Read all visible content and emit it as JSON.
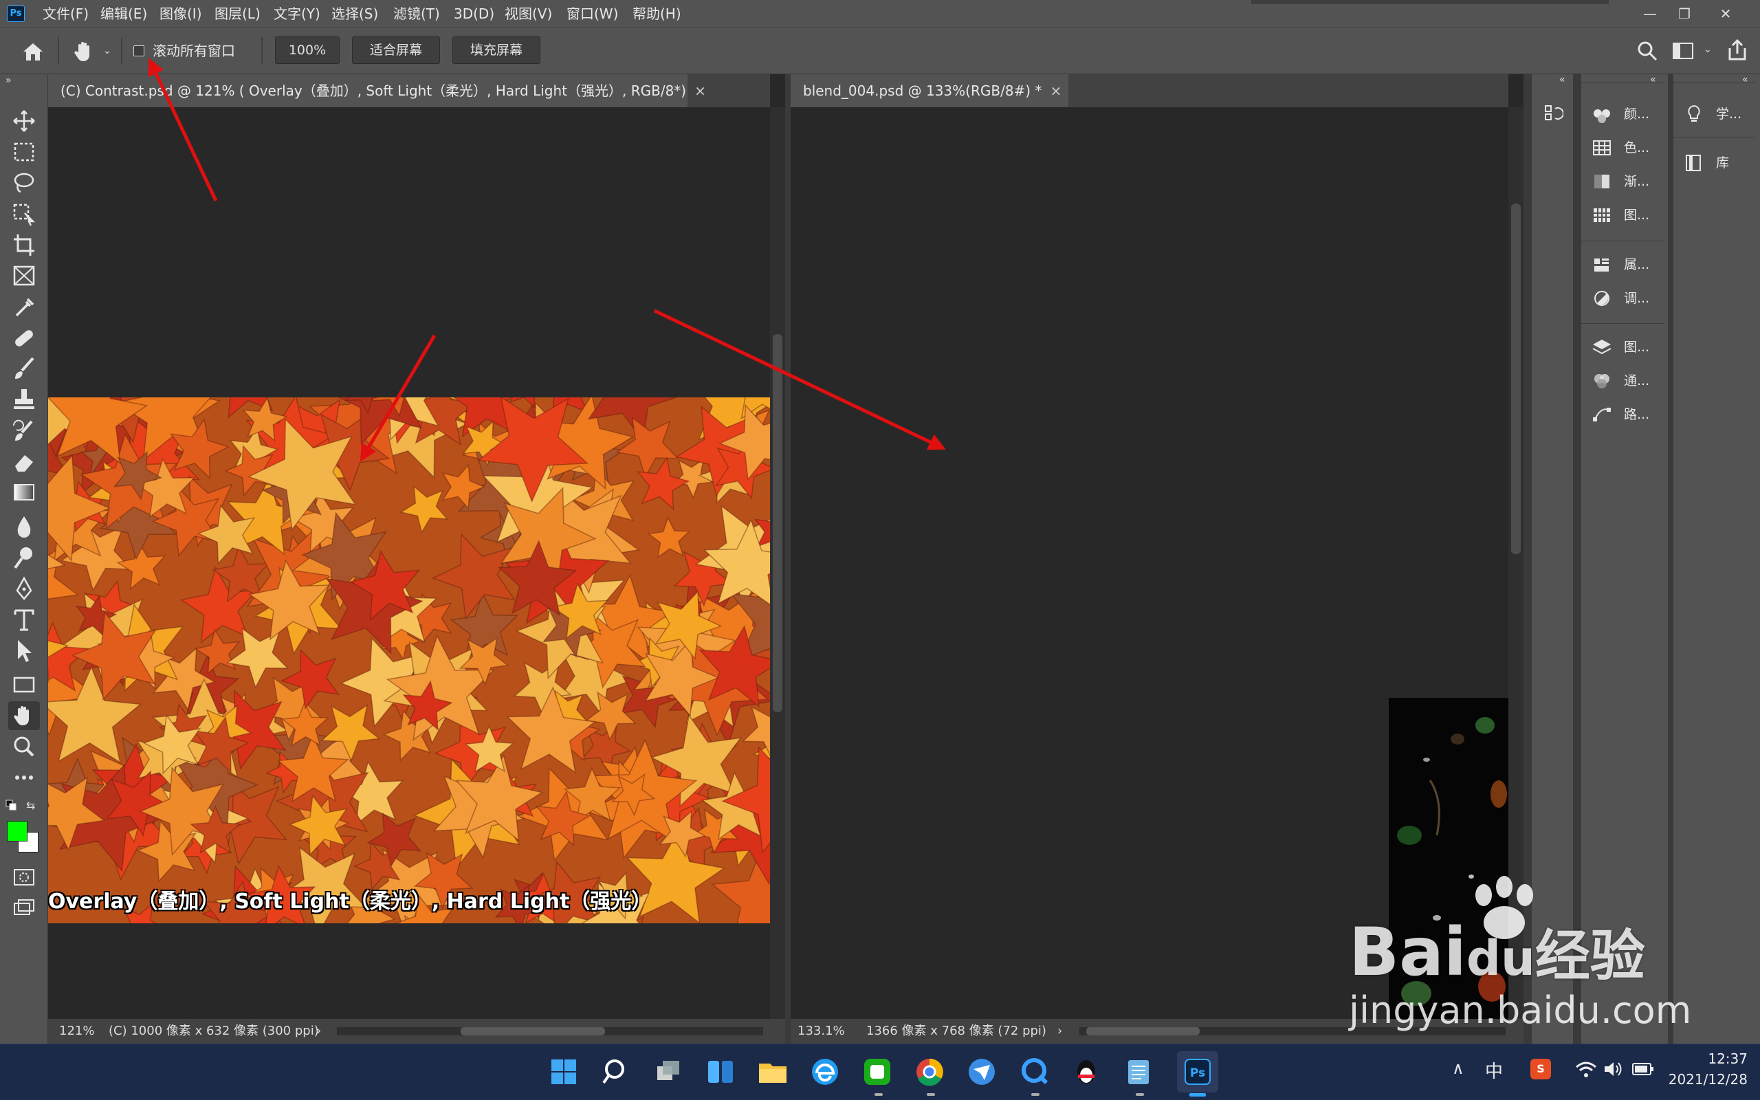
{
  "app": {
    "logo": "Ps"
  },
  "menu": [
    "文件(F)",
    "编辑(E)",
    "图像(I)",
    "图层(L)",
    "文字(Y)",
    "选择(S)",
    "滤镜(T)",
    "3D(D)",
    "视图(V)",
    "窗口(W)",
    "帮助(H)"
  ],
  "window_controls": {
    "minimize": "—",
    "restore": "❐",
    "close": "✕"
  },
  "options": {
    "scroll_all_label": "滚动所有窗口",
    "scroll_all_checked": false,
    "zoom_btn": "100%",
    "fit_screen": "适合屏幕",
    "fill_screen": "填充屏幕"
  },
  "tools": [
    "move-tool-icon",
    "marquee-tool-icon",
    "lasso-tool-icon",
    "object-select-tool-icon",
    "crop-tool-icon",
    "frame-tool-icon",
    "eyedropper-tool-icon",
    "healing-brush-icon",
    "brush-tool-icon",
    "clone-stamp-icon",
    "history-brush-icon",
    "eraser-tool-icon",
    "gradient-tool-icon",
    "blur-tool-icon",
    "dodge-tool-icon",
    "pen-tool-icon",
    "type-tool-icon",
    "path-select-tool-icon",
    "rectangle-tool-icon",
    "hand-tool-icon",
    "zoom-tool-icon",
    "more-tools-icon"
  ],
  "colors": {
    "foreground": "#00ff00",
    "background": "#ffffff",
    "accent": "#31a8ff",
    "arrow": "#e01010"
  },
  "doc1": {
    "tab": "(C) Contrast.psd @ 121% ( Overlay（叠加）, Soft Light（柔光）, Hard Light（强光）, RGB/8*)",
    "close": "×",
    "caption": "Overlay（叠加）, Soft Light（柔光）, Hard Light（强光）",
    "zoom": "121%",
    "info": "(C) 1000 像素 x 632 像素 (300 ppi)",
    "info_arrow": "›"
  },
  "doc2": {
    "tab": "blend_004.psd @ 133%(RGB/8#) *",
    "close": "×",
    "zoom": "133.1%",
    "info": "1366 像素 x 768 像素 (72 ppi)",
    "info_arrow": "›"
  },
  "dock_panels": {
    "group1": [
      "颜...",
      "色...",
      "渐...",
      "图..."
    ],
    "group2": [
      "属...",
      "调..."
    ],
    "group3": [
      "图...",
      "通...",
      "路..."
    ],
    "group4": [
      "学...",
      "库"
    ]
  },
  "watermark": {
    "brand": "Bai",
    "brand2": "du",
    "cn": "经验",
    "url": "jingyan.baidu.com"
  },
  "tray": {
    "ime": "中",
    "time": "12:37",
    "date": "2021/12/28",
    "chevron": "∧"
  }
}
